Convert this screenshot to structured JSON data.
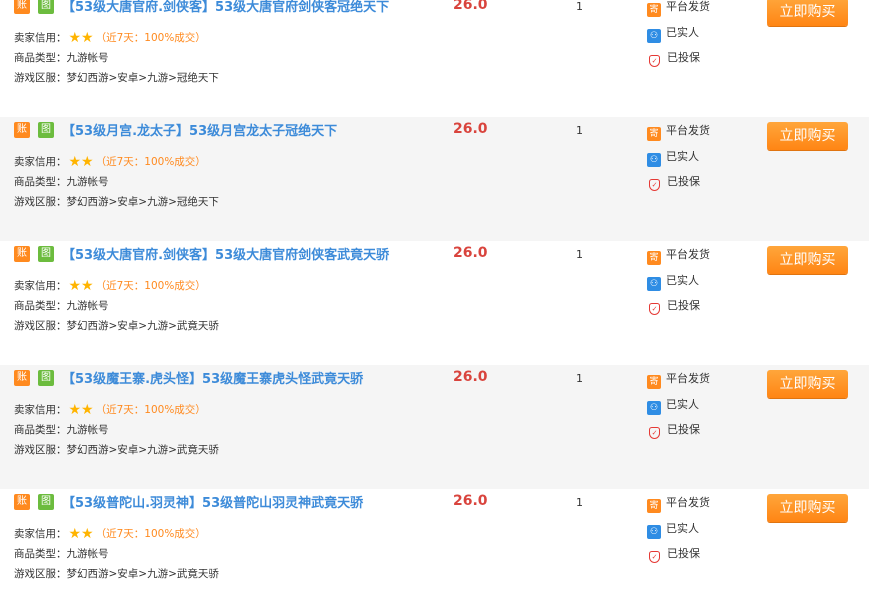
{
  "labels": {
    "tag_account": "账",
    "tag_image": "图",
    "credit": "卖家信用：",
    "type": "商品类型：",
    "server": "游戏区服：",
    "stars": "★★",
    "deal_rate": "（近7天：100%成交）",
    "svc_platform": "平台发货",
    "svc_realname": "已实人",
    "svc_insured": "已投保",
    "icon_platform": "寄",
    "icon_realname": "⚇",
    "icon_insured": "✓",
    "buy": "立即购买"
  },
  "listings": [
    {
      "title": "【53级大唐官府.剑侠客】53级大唐官府剑侠客冠绝天下",
      "price": "26.0",
      "quantity": "1",
      "product_type": "九游帐号",
      "server": "梦幻西游>安卓>九游>冠绝天下"
    },
    {
      "title": "【53级月宫.龙太子】53级月宫龙太子冠绝天下",
      "price": "26.0",
      "quantity": "1",
      "product_type": "九游帐号",
      "server": "梦幻西游>安卓>九游>冠绝天下"
    },
    {
      "title": "【53级大唐官府.剑侠客】53级大唐官府剑侠客武竟天骄",
      "price": "26.0",
      "quantity": "1",
      "product_type": "九游帐号",
      "server": "梦幻西游>安卓>九游>武竟天骄"
    },
    {
      "title": "【53级魔王寨.虎头怪】53级魔王寨虎头怪武竟天骄",
      "price": "26.0",
      "quantity": "1",
      "product_type": "九游帐号",
      "server": "梦幻西游>安卓>九游>武竟天骄"
    },
    {
      "title": "【53级普陀山.羽灵神】53级普陀山羽灵神武竟天骄",
      "price": "26.0",
      "quantity": "1",
      "product_type": "九游帐号",
      "server": "梦幻西游>安卓>九游>武竟天骄"
    }
  ]
}
